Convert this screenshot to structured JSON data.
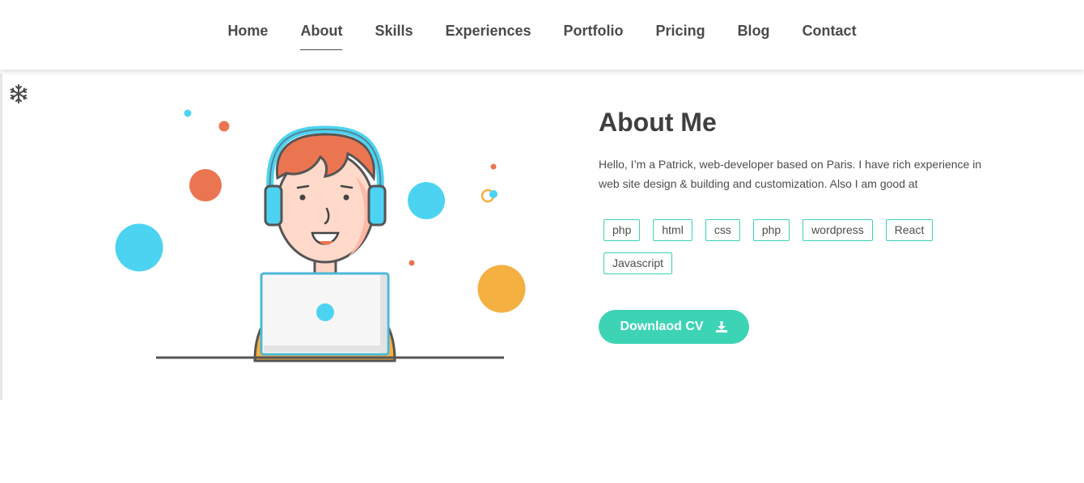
{
  "nav": {
    "items": [
      {
        "label": "Home"
      },
      {
        "label": "About",
        "active": true
      },
      {
        "label": "Skills"
      },
      {
        "label": "Experiences"
      },
      {
        "label": "Portfolio"
      },
      {
        "label": "Pricing"
      },
      {
        "label": "Blog"
      },
      {
        "label": "Contact"
      }
    ]
  },
  "icons": {
    "corner": "snowflake-icon",
    "button": "download-icon"
  },
  "about": {
    "title": "About Me",
    "text": "Hello, I’m a Patrick, web-developer based on Paris. I have rich experience in web site design & building and customization. Also I am good at",
    "tags": [
      "php",
      "html",
      "css",
      "php",
      "wordpress",
      "React",
      "Javascript"
    ],
    "button_label": "Downlaod CV"
  },
  "colors": {
    "accent": "#3dd4b5",
    "orange": "#ec7551",
    "cyan": "#4dd3f2",
    "yellow": "#f5b042",
    "text": "#444444"
  }
}
